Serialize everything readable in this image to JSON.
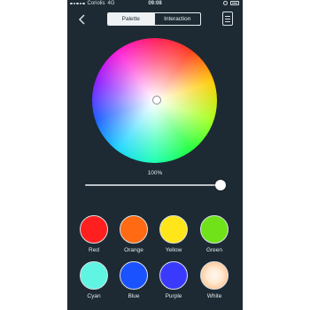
{
  "status_bar": {
    "carrier": "Coriolis",
    "network": "4G",
    "time": "09:08"
  },
  "nav": {
    "tabs": [
      {
        "label": "Palette",
        "active": true
      },
      {
        "label": "Interaction",
        "active": false
      }
    ]
  },
  "brightness": {
    "label": "100%",
    "value": 1.0
  },
  "swatches": [
    {
      "label": "Red",
      "color": "#ff1f1f"
    },
    {
      "label": "Orange",
      "color": "#ff6a12"
    },
    {
      "label": "Yellow",
      "color": "#ffe61a"
    },
    {
      "label": "Green",
      "color": "#6fe21a"
    },
    {
      "label": "Cyan",
      "color": "#5ff5e2"
    },
    {
      "label": "Blue",
      "color": "#1a52ff"
    },
    {
      "label": "Purple",
      "color": "#3a3aff"
    },
    {
      "label": "White",
      "color": "#ffffff"
    }
  ]
}
